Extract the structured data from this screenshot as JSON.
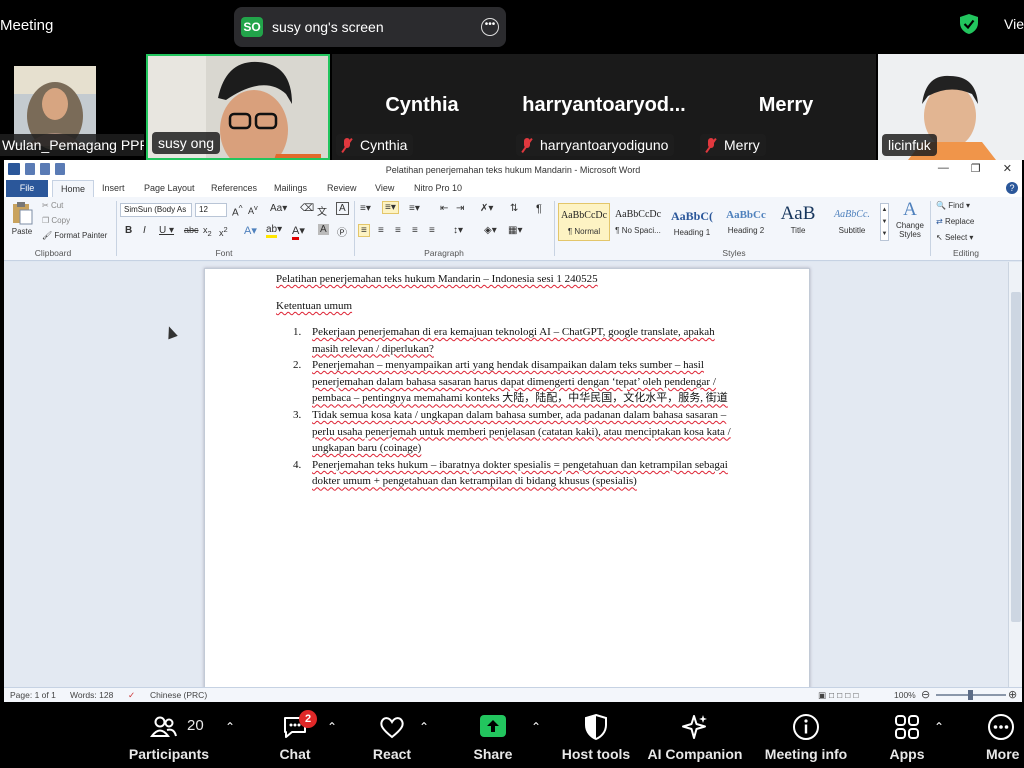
{
  "topbar": {
    "meeting_title": "Meeting",
    "share_badge": "SO",
    "share_label": "susy ong's screen",
    "view_label": "View"
  },
  "participants_strip": [
    {
      "name": "Wulan_Pemagang PPP",
      "kind": "video"
    },
    {
      "name": "susy ong",
      "kind": "video",
      "active": true
    },
    {
      "name": "Cynthia",
      "display": "Cynthia",
      "kind": "name",
      "muted": true
    },
    {
      "name": "harryantoaryodiguno",
      "display": "harryantoaryod...",
      "kind": "name",
      "muted": true
    },
    {
      "name": "Merry",
      "display": "Merry",
      "kind": "name",
      "muted": true
    },
    {
      "name": "licinfuk",
      "kind": "video"
    }
  ],
  "word": {
    "window_title": "Pelatihan penerjemahan teks hukum Mandarin  -  Microsoft Word",
    "tabs": [
      "File",
      "Home",
      "Insert",
      "Page Layout",
      "References",
      "Mailings",
      "Review",
      "View",
      "Nitro Pro 10"
    ],
    "clipboard": {
      "paste": "Paste",
      "cut": "Cut",
      "copy": "Copy",
      "format_painter": "Format Painter",
      "label": "Clipboard"
    },
    "font": {
      "name": "SimSun (Body As",
      "size": "12",
      "label": "Font"
    },
    "paragraph": {
      "label": "Paragraph"
    },
    "styles": {
      "items": [
        {
          "sample": "AaBbCcDc",
          "name": "¶ Normal"
        },
        {
          "sample": "AaBbCcDc",
          "name": "¶ No Spaci..."
        },
        {
          "sample": "AaBbC(",
          "name": "Heading 1"
        },
        {
          "sample": "AaBbCc",
          "name": "Heading 2"
        },
        {
          "sample": "AaB",
          "name": "Title"
        },
        {
          "sample": "AaBbCc.",
          "name": "Subtitle"
        }
      ],
      "change_styles": "Change Styles",
      "label": "Styles"
    },
    "editing": {
      "find": "Find",
      "replace": "Replace",
      "select": "Select",
      "label": "Editing"
    },
    "document": {
      "title": "Pelatihan penerjemahan teks hukum Mandarin – Indonesia   sesi 1  240525",
      "subtitle": "Ketentuan umum",
      "items": [
        {
          "no": "1.",
          "text": "Pekerjaan penerjemahan  di era kemajuan teknologi AI – ChatGPT, google translate, apakah masih relevan / diperlukan?"
        },
        {
          "no": "2.",
          "text": "Penerjemahan – menyampaikan arti yang hendak disampaikan dalam teks sumber – hasil penerjemahan dalam bahasa sasaran harus dapat dimengerti dengan ‘tepat’ oleh pendengar / pembaca – pentingnya memahami konteks 大陆，陆配，中华民国，文化水平，服务, 街道"
        },
        {
          "no": "3.",
          "text": "Tidak semua kosa kata / ungkapan dalam bahasa sumber, ada padanan dalam bahasa sasaran – perlu usaha penerjemah untuk memberi penjelasan (catatan kaki), atau menciptakan kosa  kata / ungkapan baru (coinage)"
        },
        {
          "no": "4.",
          "text": "Penerjemahan teks hukum – ibaratnya dokter spesialis  = pengetahuan dan ketrampilan sebagai dokter umum + pengetahuan dan ketrampilan di bidang khusus (spesialis)"
        }
      ]
    },
    "status": {
      "page": "Page: 1 of 1",
      "words": "Words: 128",
      "language": "Chinese (PRC)",
      "zoom": "100%"
    }
  },
  "toolbar": {
    "participants": {
      "label": "Participants",
      "count": "20"
    },
    "chat": {
      "label": "Chat",
      "badge": "2"
    },
    "react": {
      "label": "React"
    },
    "share": {
      "label": "Share"
    },
    "host_tools": {
      "label": "Host tools"
    },
    "ai_companion": {
      "label": "AI Companion"
    },
    "meeting_info": {
      "label": "Meeting info"
    },
    "apps": {
      "label": "Apps"
    },
    "more": {
      "label": "More"
    }
  },
  "colors": {
    "zoom_bg": "#000000",
    "active_speaker": "#22c55e",
    "share_green": "#22a44a",
    "badge_red": "#e02828",
    "word_blue": "#2b579a"
  }
}
